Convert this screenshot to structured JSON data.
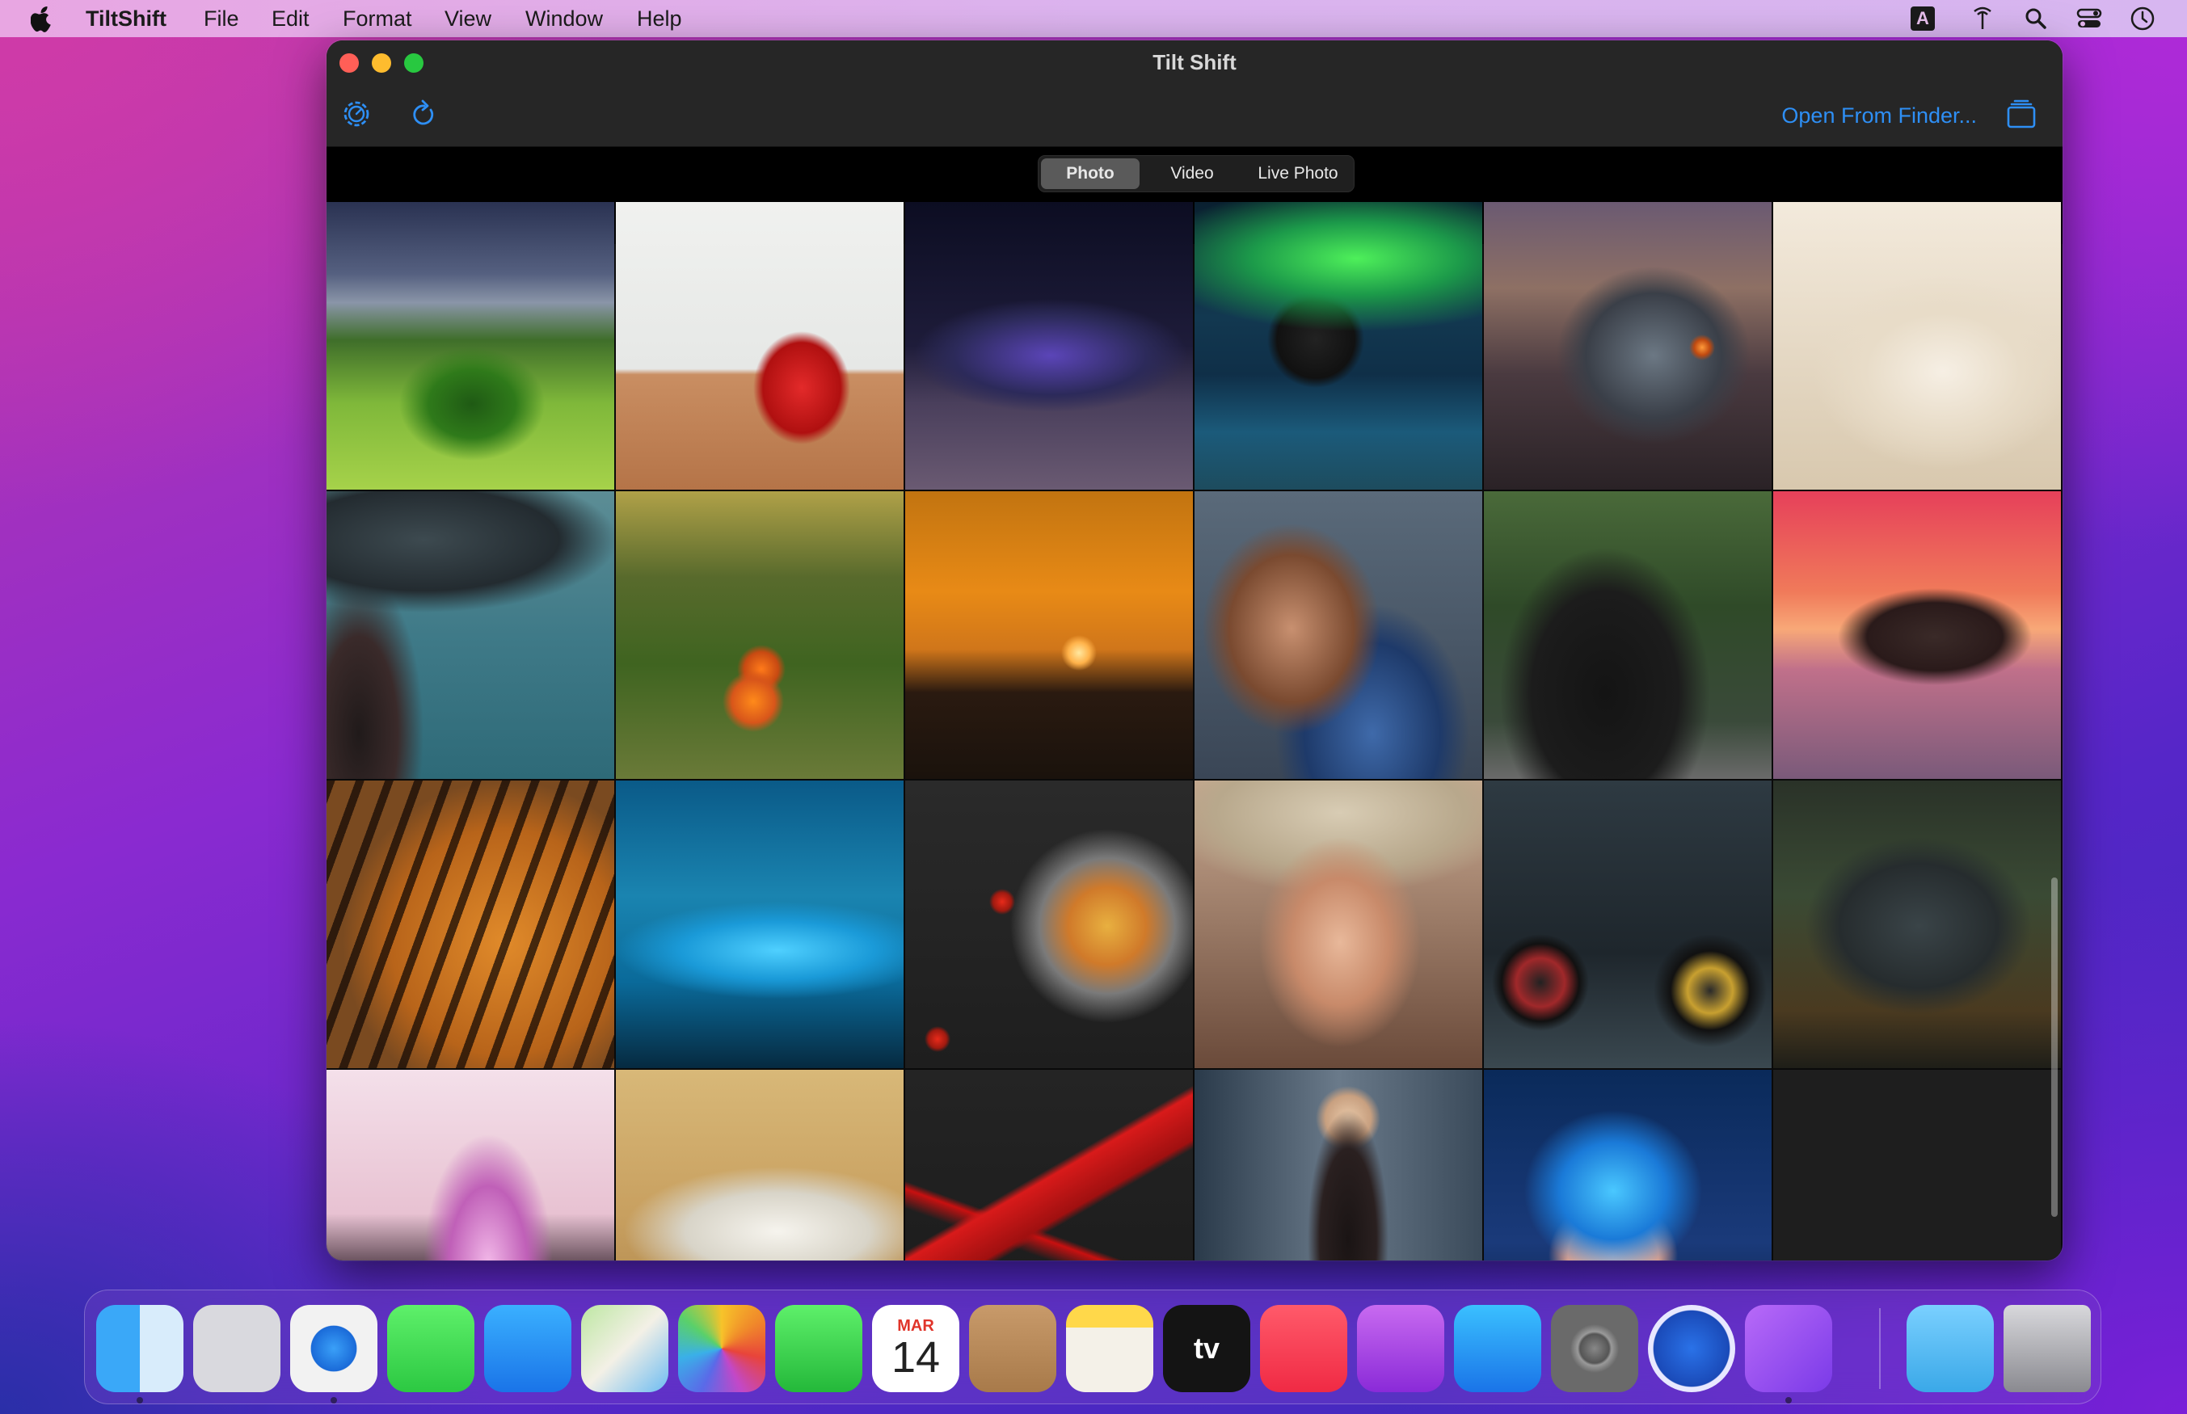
{
  "menubar": {
    "app_name": "TiltShift",
    "items": [
      "File",
      "Edit",
      "Format",
      "View",
      "Window",
      "Help"
    ],
    "status_icons": [
      "input-source-icon",
      "antenna-icon",
      "spotlight-search-icon",
      "control-center-icon",
      "clock-icon"
    ],
    "input_source_letter": "A"
  },
  "window": {
    "title": "Tilt Shift",
    "toolbar": {
      "settings_icon": "settings-gear-icon",
      "refresh_icon": "refresh-icon",
      "open_from_finder_label": "Open From Finder...",
      "stack_icon": "stack-icon"
    },
    "segments": [
      "Photo",
      "Video",
      "Live Photo"
    ],
    "selected_segment": "Photo",
    "grid_items": [
      "Green valley landscape",
      "Strawberry",
      "Purple sports car",
      "Aurora over sea",
      "Sci-fi structure",
      "White cat",
      "Woman with hat",
      "Orange tree",
      "Sailboat sunset",
      "Cartoon character",
      "Woman on horse",
      "Island sunset",
      "Tiger",
      "Blue water",
      "Pasta dish",
      "Portrait woman",
      "Motorcycle",
      "Old house",
      "Pink crystals",
      "White car",
      "ROG logo",
      "Fashion woman",
      "Anime character"
    ]
  },
  "accent_color": "#2e8ff5",
  "dock": {
    "apps": [
      {
        "name": "Finder",
        "icon": "finder-icon"
      },
      {
        "name": "Launchpad",
        "icon": "launchpad-icon"
      },
      {
        "name": "Safari",
        "icon": "safari-icon"
      },
      {
        "name": "Messages",
        "icon": "messages-icon"
      },
      {
        "name": "Mail",
        "icon": "mail-icon"
      },
      {
        "name": "Maps",
        "icon": "maps-icon"
      },
      {
        "name": "Photos",
        "icon": "photos-icon"
      },
      {
        "name": "FaceTime",
        "icon": "facetime-icon"
      },
      {
        "name": "Calendar",
        "icon": "calendar-icon"
      },
      {
        "name": "Contacts",
        "icon": "contacts-icon"
      },
      {
        "name": "Notes",
        "icon": "notes-icon"
      },
      {
        "name": "TV",
        "icon": "apple-tv-icon"
      },
      {
        "name": "Music",
        "icon": "music-icon"
      },
      {
        "name": "Podcasts",
        "icon": "podcasts-icon"
      },
      {
        "name": "App Store",
        "icon": "app-store-icon"
      },
      {
        "name": "System Preferences",
        "icon": "system-preferences-icon"
      },
      {
        "name": "Mountain",
        "icon": "mountain-app-icon"
      },
      {
        "name": "TiltShift",
        "icon": "tiltshift-app-icon"
      },
      {
        "name": "Downloads",
        "icon": "downloads-folder-icon"
      },
      {
        "name": "Trash",
        "icon": "trash-icon"
      }
    ],
    "calendar_month": "MAR",
    "calendar_day": "14",
    "tv_label": "tv"
  }
}
